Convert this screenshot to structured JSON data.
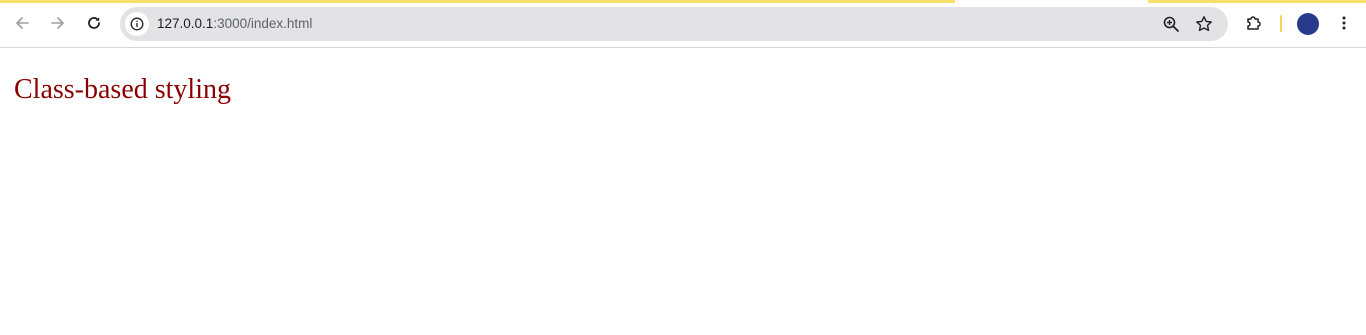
{
  "browser": {
    "address_bar": {
      "host": "127.0.0.1",
      "path": ":3000/index.html"
    },
    "icons": {
      "back": "arrow-left-icon",
      "forward": "arrow-right-icon",
      "reload": "reload-icon",
      "site_info": "info-icon",
      "zoom": "zoom-in-icon",
      "bookmark": "star-icon",
      "extensions": "puzzle-icon",
      "profile": "avatar",
      "menu": "kebab-menu-icon"
    },
    "colors": {
      "omnibox_bg": "#e3e3e5",
      "accent": "#f5e16a",
      "avatar_bg": "#2a3a8a"
    }
  },
  "page": {
    "heading": "Class-based styling",
    "heading_color": "#8b0000"
  }
}
